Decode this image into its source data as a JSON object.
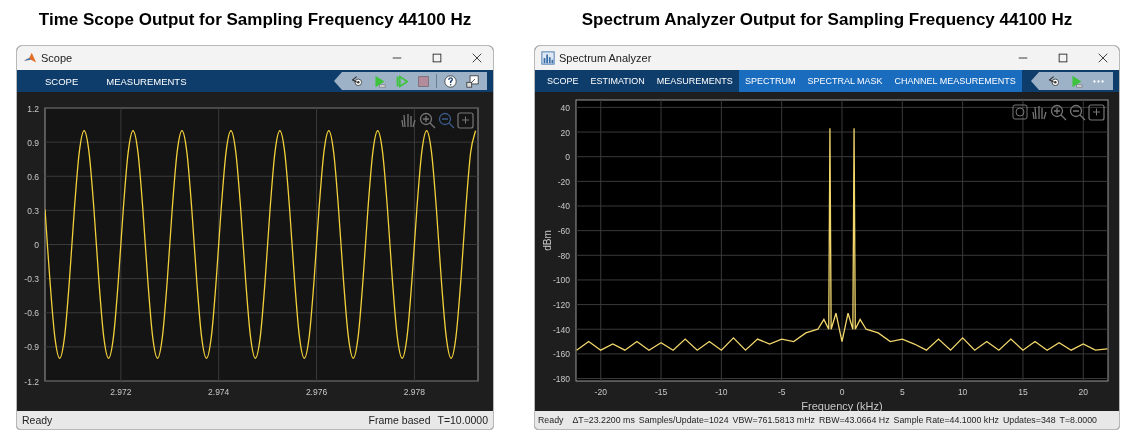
{
  "panels": [
    {
      "kind": "time_scope",
      "heading": "Time Scope Output for Sampling Frequency 44100 Hz",
      "window": {
        "title": "Scope"
      },
      "tabs": [
        {
          "label": "SCOPE",
          "kind": "main"
        },
        {
          "label": "MEASUREMENTS",
          "kind": "main"
        }
      ],
      "chart_data": {
        "type": "line",
        "grid": true,
        "xlim": [
          2.97045,
          2.9793
        ],
        "ylim": [
          -1.2,
          1.2
        ],
        "xticks": [
          2.972,
          2.974,
          2.976,
          2.978
        ],
        "yticks": [
          1.2,
          0.9,
          0.6,
          0.3,
          0,
          -0.3,
          -0.6,
          -0.9,
          -1.2
        ],
        "x": [
          2.97045,
          2.97055,
          2.97065,
          2.97075,
          2.97085,
          2.97095,
          2.97105,
          2.97115,
          2.97125,
          2.97135,
          2.97145,
          2.97155,
          2.97165,
          2.97175,
          2.97185,
          2.97195,
          2.97205,
          2.97215,
          2.97225,
          2.97235,
          2.97245,
          2.97255,
          2.97265,
          2.97275,
          2.97285,
          2.97295,
          2.97305,
          2.97315,
          2.97325,
          2.97335,
          2.97345,
          2.97355,
          2.97365,
          2.97375,
          2.97385,
          2.97395,
          2.97405,
          2.97415,
          2.97425,
          2.97435,
          2.97445,
          2.97455,
          2.97465,
          2.97475,
          2.97485,
          2.97495,
          2.97505,
          2.97515,
          2.97525,
          2.97535,
          2.97545,
          2.97555,
          2.97565,
          2.97575,
          2.97585,
          2.97595,
          2.97605,
          2.97615,
          2.97625,
          2.97635,
          2.97645,
          2.97655,
          2.97665,
          2.97675,
          2.97685,
          2.97695,
          2.97705,
          2.97715,
          2.97725,
          2.97735,
          2.97745,
          2.97755,
          2.97765,
          2.97775,
          2.97785,
          2.97795,
          2.97805,
          2.97815,
          2.97825,
          2.97835,
          2.97845,
          2.97855,
          2.97865,
          2.97875,
          2.97885,
          2.97895,
          2.97905,
          2.97915,
          2.97925
        ],
        "series": [
          {
            "color": "#f2d03b",
            "values": [
              0.31,
              -0.31,
              -0.81,
              -1,
              -0.81,
              -0.31,
              0.31,
              0.81,
              1,
              0.81,
              0.31,
              -0.31,
              -0.81,
              -1,
              -0.81,
              -0.31,
              0.31,
              0.81,
              1,
              0.81,
              0.31,
              -0.31,
              -0.81,
              -1,
              -0.81,
              -0.31,
              0.31,
              0.81,
              1,
              0.81,
              0.31,
              -0.31,
              -0.81,
              -1,
              -0.81,
              -0.31,
              0.31,
              0.81,
              1,
              0.81,
              0.31,
              -0.31,
              -0.81,
              -1,
              -0.81,
              -0.31,
              0.31,
              0.81,
              1,
              0.81,
              0.31,
              -0.31,
              -0.81,
              -1,
              -0.81,
              -0.31,
              0.31,
              0.81,
              1,
              0.81,
              0.31,
              -0.31,
              -0.81,
              -1,
              -0.81,
              -0.31,
              0.31,
              0.81,
              1,
              0.81,
              0.31,
              -0.31,
              -0.81,
              -1,
              -0.81,
              -0.31,
              0.31,
              0.81,
              1,
              0.81,
              0.31,
              -0.31,
              -0.81,
              -1,
              -0.81,
              -0.31,
              0.31,
              0.81,
              1
            ]
          }
        ]
      },
      "status_bar": {
        "left": [
          "Ready"
        ],
        "right": [
          "Frame based",
          "T=10.0000"
        ]
      }
    },
    {
      "kind": "spectrum_analyzer",
      "heading": "Spectrum Analyzer Output for Sampling Frequency 44100 Hz",
      "window": {
        "title": "Spectrum Analyzer"
      },
      "tabs": [
        {
          "label": "SCOPE",
          "kind": "main"
        },
        {
          "label": "ESTIMATION",
          "kind": "main"
        },
        {
          "label": "MEASUREMENTS",
          "kind": "main"
        },
        {
          "label": "SPECTRUM",
          "kind": "contextual"
        },
        {
          "label": "SPECTRAL MASK",
          "kind": "contextual"
        },
        {
          "label": "CHANNEL MEASUREMENTS",
          "kind": "contextual"
        }
      ],
      "chart_data": {
        "type": "line",
        "grid": true,
        "xlabel": "Frequency (kHz)",
        "ylabel": "dBm",
        "xlim": [
          -22.05,
          22.05
        ],
        "ylim": [
          -182,
          46
        ],
        "xticks": [
          -20,
          -15,
          -10,
          -5,
          0,
          5,
          10,
          15,
          20
        ],
        "yticks": [
          40,
          20,
          0,
          -20,
          -40,
          -60,
          -80,
          -100,
          -120,
          -140,
          -160,
          -180
        ],
        "x": [
          -22,
          -21,
          -20,
          -19,
          -18,
          -17,
          -16,
          -15,
          -14,
          -13,
          -12,
          -11,
          -10,
          -9,
          -8,
          -7,
          -6,
          -5,
          -4,
          -3,
          -2,
          -1.5,
          -1.1,
          -1,
          -0.9,
          -0.5,
          0,
          0.5,
          0.9,
          1,
          1.1,
          1.5,
          2,
          3,
          4,
          5,
          6,
          7,
          8,
          9,
          10,
          11,
          12,
          13,
          14,
          15,
          16,
          17,
          18,
          19,
          20,
          21,
          22
        ],
        "series": [
          {
            "color": "#f2d76b",
            "values": [
              -157,
              -150,
              -157,
              -152,
              -157,
              -150,
              -157,
              -151,
              -157,
              -148,
              -157,
              -150,
              -157,
              -147,
              -157,
              -148,
              -152,
              -148,
              -150,
              -143,
              -140,
              -132,
              -140,
              23,
              -140,
              -127,
              -150,
              -127,
              -140,
              23,
              -140,
              -132,
              -140,
              -143,
              -150,
              -148,
              -152,
              -157,
              -148,
              -157,
              -147,
              -157,
              -150,
              -157,
              -148,
              -157,
              -150,
              -157,
              -151,
              -157,
              -152,
              -157,
              -156
            ]
          }
        ]
      },
      "status_bar": {
        "left": [
          "Ready",
          "ΔT=23.2200 ms",
          "Samples/Update=1024",
          "VBW=761.5813 mHz",
          "RBW=43.0664 Hz",
          "Sample Rate=44.1000 kHz",
          "Updates=348",
          "T=8.0000"
        ]
      }
    }
  ]
}
